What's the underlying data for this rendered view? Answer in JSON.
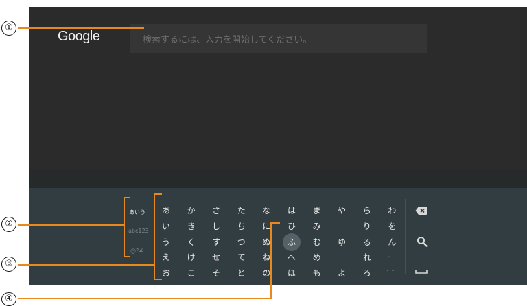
{
  "search": {
    "logo": "Google",
    "placeholder": "検索するには、入力を開始してください。"
  },
  "keyboard": {
    "modes": [
      "あいう",
      "abc123",
      "@?#"
    ],
    "columns": [
      [
        "あ",
        "い",
        "う",
        "え",
        "お"
      ],
      [
        "か",
        "き",
        "く",
        "け",
        "こ"
      ],
      [
        "さ",
        "し",
        "す",
        "せ",
        "そ"
      ],
      [
        "た",
        "ち",
        "つ",
        "て",
        "と"
      ],
      [
        "な",
        "に",
        "ぬ",
        "ね",
        "の"
      ],
      [
        "は",
        "ひ",
        "ふ",
        "へ",
        "ほ"
      ],
      [
        "ま",
        "み",
        "む",
        "め",
        "も"
      ],
      [
        "や",
        "",
        "ゆ",
        "",
        "よ"
      ],
      [
        "ら",
        "り",
        "る",
        "れ",
        "ろ"
      ],
      [
        "わ",
        "を",
        "ん",
        "ー",
        "゛゜"
      ]
    ],
    "selected": "ふ",
    "actions": [
      "backspace-icon",
      "search-icon",
      "space-icon"
    ]
  },
  "callouts": [
    "①",
    "②",
    "③",
    "④"
  ],
  "colors": {
    "screen": "#2b2b2b",
    "keyboard": "#323d42",
    "callout_line": "#e8891d",
    "focus": "#556166"
  }
}
